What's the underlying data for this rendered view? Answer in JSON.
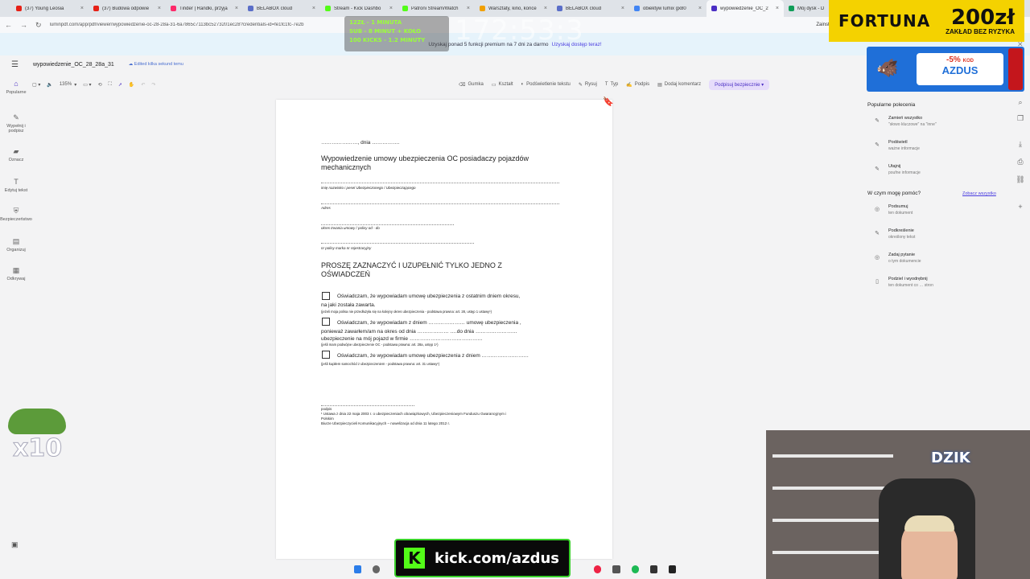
{
  "browser": {
    "tabs": [
      {
        "title": "(37) Young Leosia",
        "color": "#e62117"
      },
      {
        "title": "(37) Budowa odpowie",
        "color": "#e62117"
      },
      {
        "title": "Tinder | Randki, przyja",
        "color": "#fd2a6a"
      },
      {
        "title": "BELABOX cloud",
        "color": "#5a6ec8"
      },
      {
        "title": "Stream - Kick Dashbo",
        "color": "#53fc18"
      },
      {
        "title": "Patroni Stream/Watch",
        "color": "#53fc18"
      },
      {
        "title": "Warsztaty, kino, konce",
        "color": "#f1a000"
      },
      {
        "title": "BELABOX cloud",
        "color": "#5a6ec8"
      },
      {
        "title": "obiektyw lumix gx80",
        "color": "#4285f4"
      },
      {
        "title": "wypowiedzenie_OC_2",
        "color": "#4b2fc4"
      },
      {
        "title": "Mój dysk - D",
        "color": "#0f9d58"
      }
    ],
    "url": "luminpdf.com/app/pdf/viewer/wypowiedzenie-oc-28-28a-31-6a7865c7113bc5273201ec28?credentials-id=fe1fc1fc-7e2b",
    "install_label": "Zainsta"
  },
  "promo": {
    "text": "Uzyskaj ponad 5 funkcji premium na 7 dni za darmo",
    "cta": "Uzyskaj dostęp teraz!"
  },
  "app": {
    "doc_title": "wypowiedzenie_OC_28_28a_31",
    "saved_status": "Edited kilka sekund temu"
  },
  "toolbar": {
    "zoom": "135%",
    "tools": [
      "Gumka",
      "Kształt",
      "Podświetlenie tekstu",
      "Rysuj",
      "Typ",
      "Podpis",
      "Dodaj komentarz"
    ],
    "sign_button": "Podpisuj bezpiecznie"
  },
  "sidebar": {
    "items": [
      {
        "label": "Popularne",
        "icon": "home-icon"
      },
      {
        "label": "Wypełnij i podpisz",
        "icon": "pen-icon"
      },
      {
        "label": "Oznacz",
        "icon": "marker-icon"
      },
      {
        "label": "Edytuj tekst",
        "icon": "text-edit-icon"
      },
      {
        "label": "Bezpieczeństwo",
        "icon": "shield-icon"
      },
      {
        "label": "Organizuj",
        "icon": "pages-icon"
      },
      {
        "label": "Odkrywaj",
        "icon": "grid-icon"
      }
    ]
  },
  "document": {
    "date_line": "…………………, dnia …………….",
    "title_line1": "Wypowiedzenie umowy ubezpieczenia OC posiadaczy pojazdów",
    "title_line2": "mechanicznych",
    "field1": "imię nazwisko i pesel Ubezpieczonego / Ubezpieczającego",
    "field2": "Adres",
    "field3": "okres trwania umowy / polisy od - do",
    "field4": "nr polisy marka nr rejestracyjny",
    "heading_line1": "PROSZĘ ZAZNACZYĆ I UZUPEŁNIĆ TYLKO JEDNO Z",
    "heading_line2": "OŚWIADCZEŃ",
    "opt1_line1": "Oświadczam, że wypowiadam umowę ubezpieczenia z ostatnim dniem okresu,",
    "opt1_line2": "na jaki została zawarta.",
    "opt1_note": "(jeżeli moja polisa nie przedłużyła się na kolejny okres ubezpieczenia - podstawa prawna: art. 28, ustęp 1 ustawy¹)",
    "opt2_line1": "Oświadczam, że wypowiadam z dniem ………………… umowę ubezpieczenia ,",
    "opt2_line2": "ponieważ zawarłem/am na okres od dnia ……………… ….do dnia ……………………",
    "opt2_line3": "ubezpieczenie na mój pojazd w firmie ……………………………………",
    "opt2_note": "(jeśli mam podwójne ubezpieczenie OC - podstawa prawna: art. 28a, ustęp 1¹)",
    "opt3_line1": "Oświadczam, że wypowiadam umowę ubezpieczenia z dniem ………………………",
    "opt3_note": "(jeśli kupiłem samochód z ubezpieczeniem - podstawa prawna: art. 31 ustawy¹)",
    "signature": "podpis",
    "footnote1": "¹ Ustawa z dnia 22 maja 2003 r. o ubezpieczeniach obowiązkowych, Ubezpieczeniowym Funduszu Gwarancyjnym i",
    "footnote2": "Polskim",
    "footnote3": "Biurze Ubezpieczycieli Komunikacyjnych – nowelizacja od dnia 11 lutego 2012 r."
  },
  "rpanel": {
    "popular_heading": "Popularne polecenia",
    "popular": [
      {
        "title": "Zamień wszystko",
        "sub": "\"słowo kluczowe\" na \"inne\""
      },
      {
        "title": "Podświetl",
        "sub": "ważne informacje"
      },
      {
        "title": "Utajnij",
        "sub": "poufne informacje"
      }
    ],
    "help_heading": "W czym mogę pomóc?",
    "help_link": "Zobacz wszystko",
    "help": [
      {
        "title": "Podsumuj",
        "sub": "ten dokument"
      },
      {
        "title": "Podkreślenie",
        "sub": "określony tekst"
      },
      {
        "title": "Zadaj pytanie",
        "sub": "o tym dokumencie"
      },
      {
        "title": "Podziel i wyodrębnij",
        "sub": "ten dokument co … stron"
      }
    ]
  },
  "overlays": {
    "goals": [
      "12ZŁ - 1 MINUTA",
      "SUB - 8 MINUT + KOŁO",
      "100 KICKS - 1.2 MINUTY"
    ],
    "timer": "172:53:3",
    "fortuna_brand": "FORTUNA",
    "fortuna_amount": "200zł",
    "fortuna_sub": "ZAKŁAD BEZ RYZYKA",
    "dzik_pct": "-5%",
    "dzik_kod": "KOD",
    "dzik_code": "AZDUS",
    "kick_url": "kick.com/azdus",
    "webcam_logo": "DZIK",
    "emote_count": "x10"
  }
}
